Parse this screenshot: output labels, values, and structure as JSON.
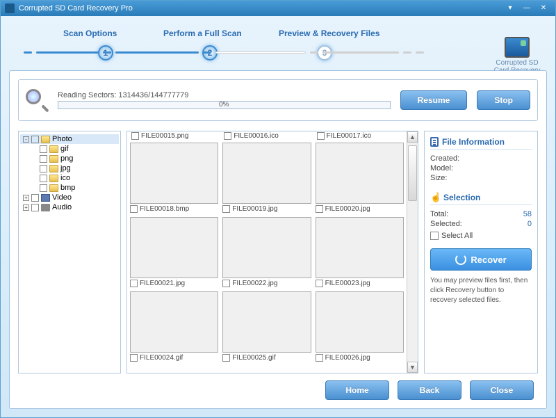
{
  "title": "Corrupted SD Card Recovery Pro",
  "steps": {
    "s1": "Scan Options",
    "s2": "Perform a Full Scan",
    "s3": "Preview & Recovery Files",
    "n1": "1",
    "n2": "2",
    "n3": "3"
  },
  "logo": {
    "line1": "Corrupted SD",
    "line2": "Card Recovery"
  },
  "scan": {
    "reading": "Reading Sectors: 1314436/144777779",
    "pct": "0%",
    "resume": "Resume",
    "stop": "Stop"
  },
  "tree": {
    "photo": "Photo",
    "gif": "gif",
    "png": "png",
    "jpg": "jpg",
    "ico": "ico",
    "bmp": "bmp",
    "video": "Video",
    "audio": "Audio"
  },
  "partial": {
    "a": "FILE00015.png",
    "b": "FILE00016.ico",
    "c": "FILE00017.ico"
  },
  "files": [
    {
      "name": "FILE00018.bmp",
      "cls": "flower-orange"
    },
    {
      "name": "FILE00019.jpg",
      "cls": "sunset"
    },
    {
      "name": "FILE00020.jpg",
      "cls": "flower-red"
    },
    {
      "name": "FILE00021.jpg",
      "cls": "hydrangea"
    },
    {
      "name": "FILE00022.jpg",
      "cls": "tulips"
    },
    {
      "name": "FILE00023.jpg",
      "cls": "desert"
    },
    {
      "name": "FILE00024.gif",
      "cls": "logos1"
    },
    {
      "name": "FILE00025.gif",
      "cls": "logos2"
    },
    {
      "name": "FILE00026.jpg",
      "cls": "gradient-blue"
    }
  ],
  "info": {
    "heading": "File Information",
    "created": "Created:",
    "model": "Model:",
    "size": "Size:",
    "sel_heading": "Selection",
    "total_lbl": "Total:",
    "total_val": "58",
    "selected_lbl": "Selected:",
    "selected_val": "0",
    "select_all": "Select All",
    "recover": "Recover",
    "tip": "You may preview files first, then click Recovery button to recovery selected files."
  },
  "footer": {
    "home": "Home",
    "back": "Back",
    "close": "Close"
  }
}
